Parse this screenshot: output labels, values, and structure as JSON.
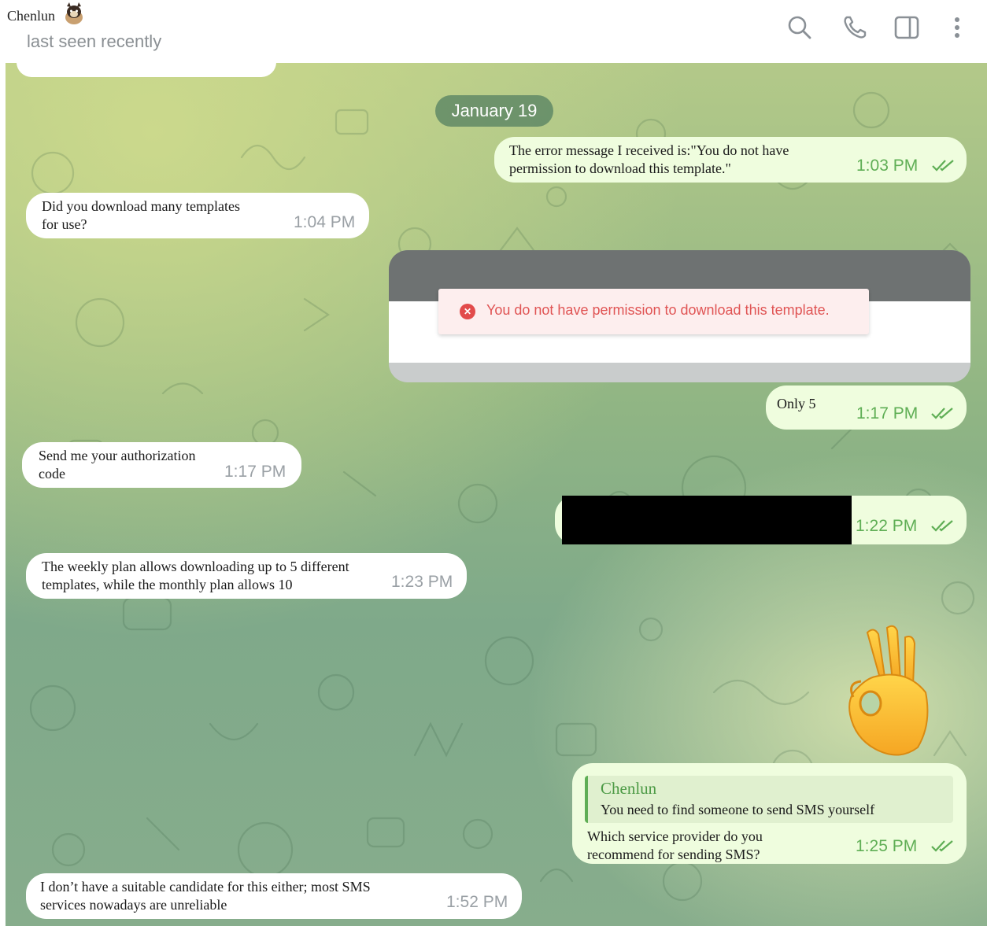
{
  "header": {
    "contact_name": "Chenlun",
    "status": "last seen recently",
    "icons": [
      "search-icon",
      "phone-icon",
      "sidebar-toggle-icon",
      "more-vertical-icon"
    ]
  },
  "date_separator": "January 19",
  "messages": [
    {
      "direction": "outgoing",
      "text": "The error message I received is:\"You do not have permission to download this template.\"",
      "time": "1:03 PM",
      "status": "read"
    },
    {
      "direction": "incoming",
      "text": "Did you download many templates for use?",
      "time": "1:04 PM"
    },
    {
      "direction": "outgoing",
      "type": "image",
      "error_text": "You do not have permission to download this template.",
      "error_icon": "error-circle-icon"
    },
    {
      "direction": "outgoing",
      "text": "Only 5",
      "time": "1:17 PM",
      "status": "read"
    },
    {
      "direction": "incoming",
      "text": "Send me your authorization code",
      "time": "1:17 PM"
    },
    {
      "direction": "outgoing",
      "type": "redacted",
      "time": "1:22 PM",
      "status": "read"
    },
    {
      "direction": "incoming",
      "text": "The weekly plan allows downloading up to 5 different templates, while the monthly plan allows 10",
      "time": "1:23 PM"
    },
    {
      "direction": "outgoing",
      "type": "emoji",
      "emoji": "ok-hand"
    },
    {
      "direction": "outgoing",
      "reply_to": {
        "name": "Chenlun",
        "text": "You need to find someone to send SMS yourself"
      },
      "text": "Which service provider do you recommend for sending SMS?",
      "time": "1:25 PM",
      "status": "read"
    },
    {
      "direction": "incoming",
      "text": "I don’t have a suitable candidate for this either; most SMS services nowadays are unreliable",
      "time": "1:52 PM"
    }
  ],
  "lines": {
    "m0": [
      "The error message I received is:\"You do not have",
      "permission to download this template.\""
    ],
    "m1": [
      "Did you download many templates",
      "for use?"
    ],
    "m4": [
      "Send me your authorization",
      "code"
    ],
    "m6": [
      "The weekly plan allows downloading up to 5 different",
      "templates, while the monthly plan allows 10"
    ],
    "m8": [
      "Which service provider do you",
      "recommend for sending SMS?"
    ],
    "m9": [
      "I don’t have a suitable candidate for this either; most SMS",
      "services nowadays are unreliable"
    ]
  },
  "colors": {
    "outgoing_bubble": "#effdde",
    "incoming_bubble": "#ffffff",
    "outgoing_time": "#5fae55",
    "accent": "#4c9a45",
    "error": "#e05454"
  }
}
